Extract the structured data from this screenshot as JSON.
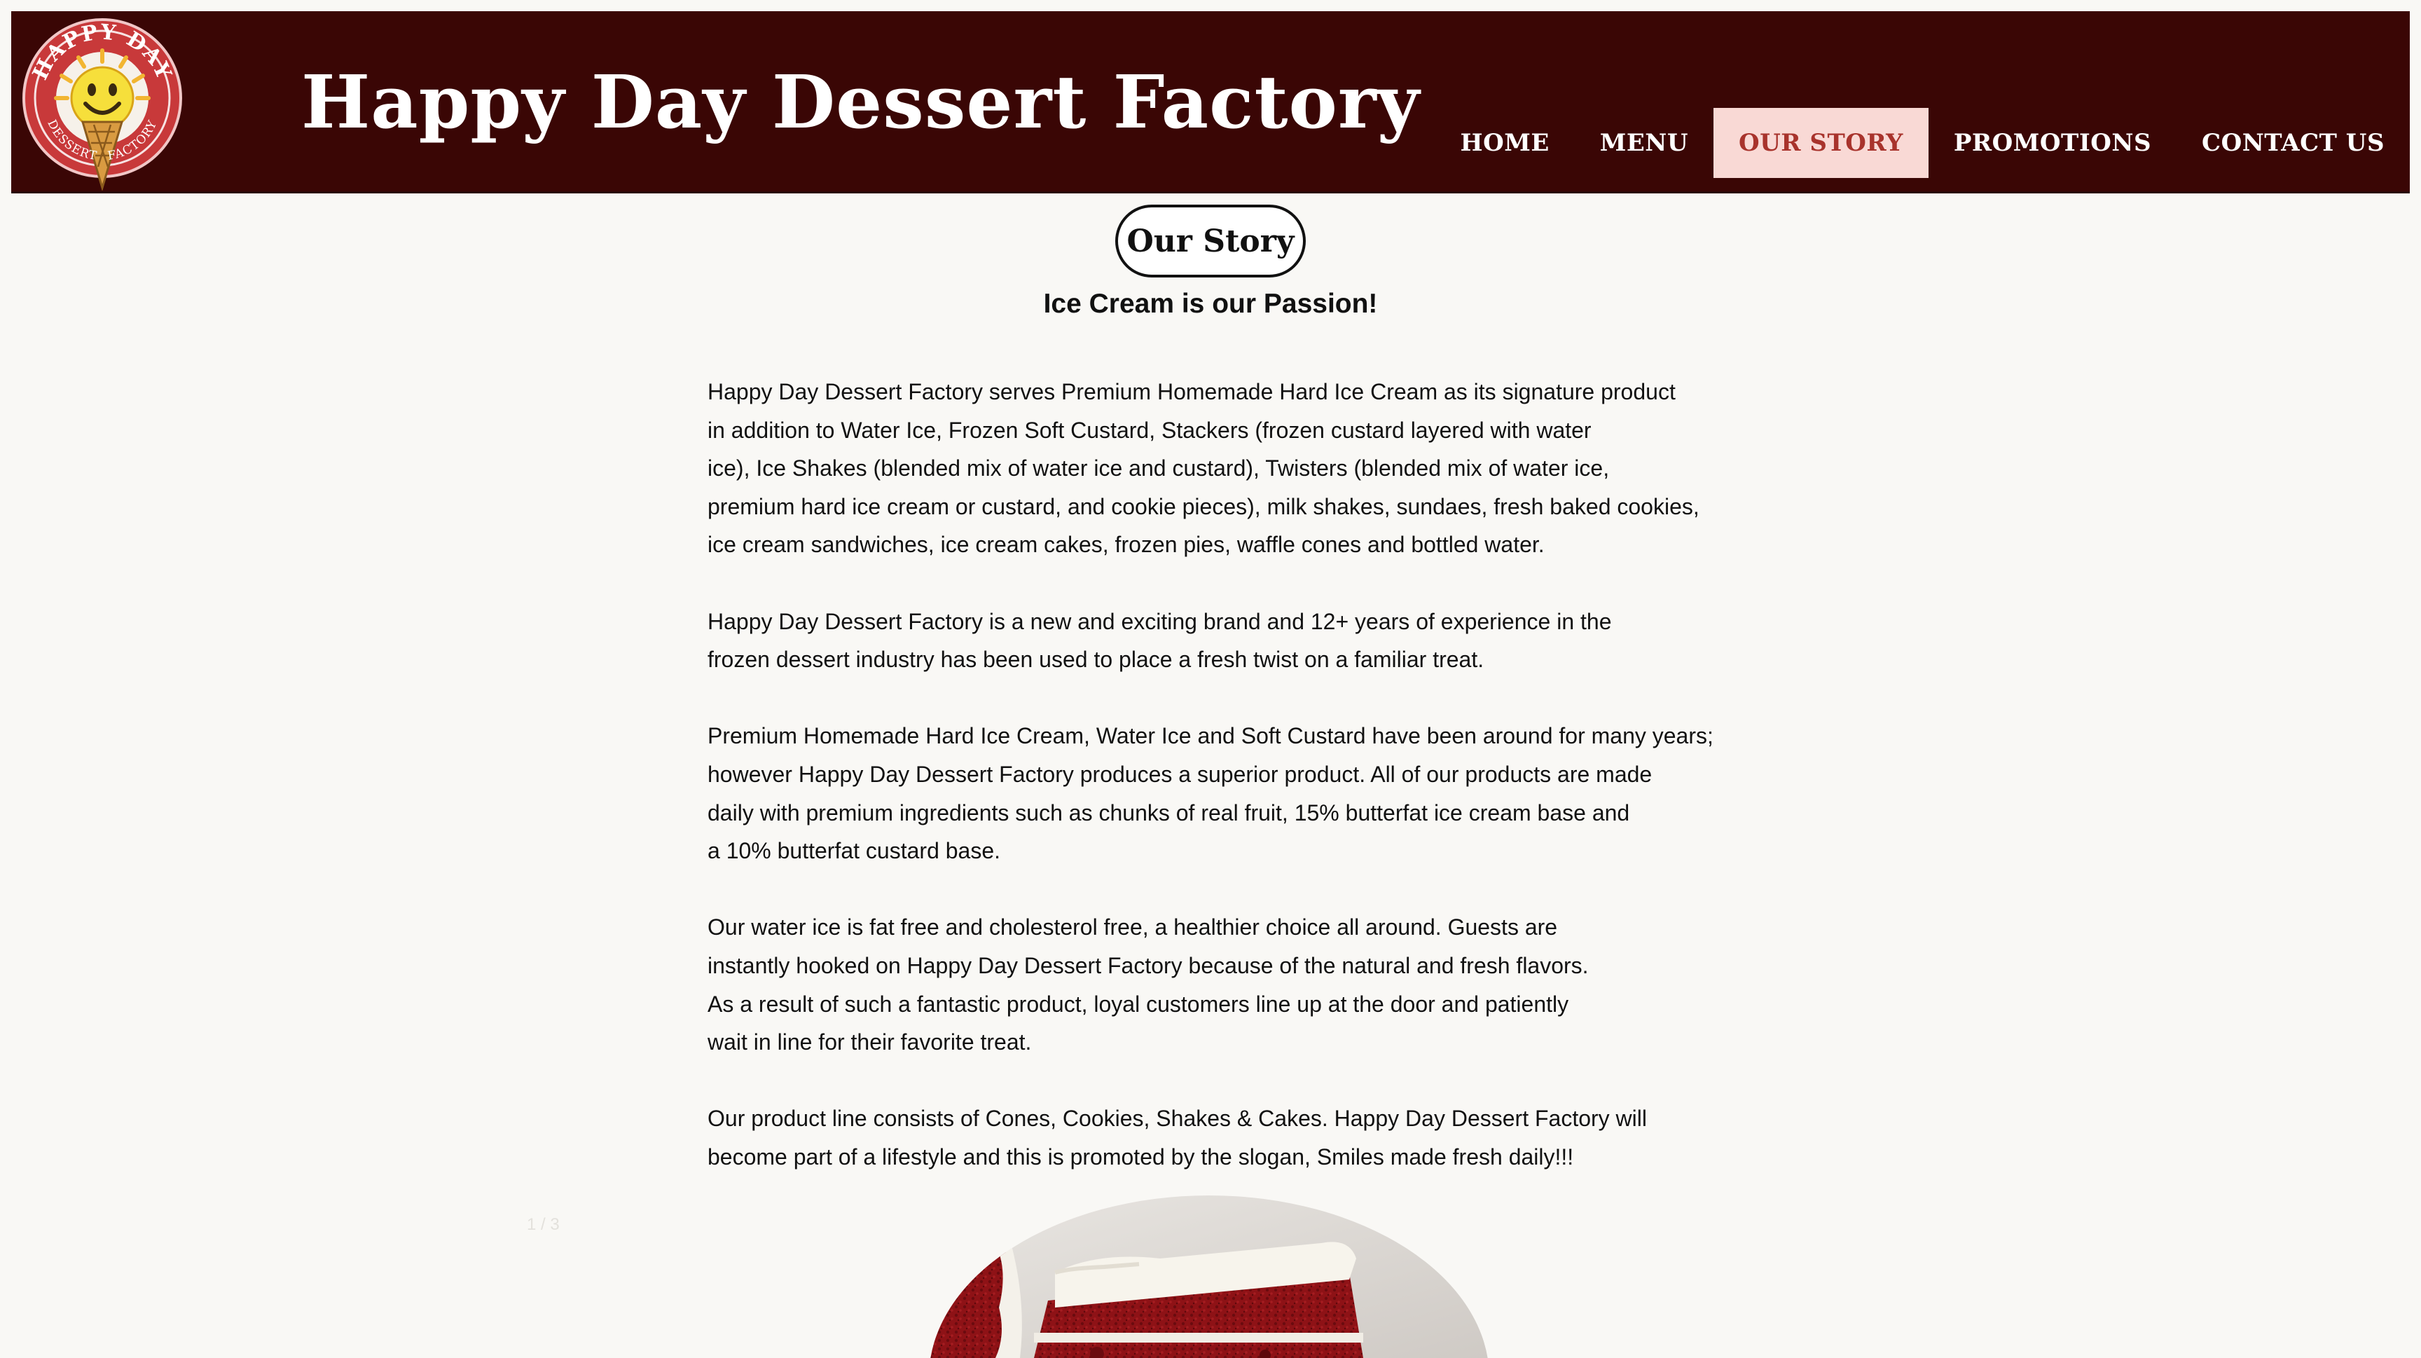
{
  "header": {
    "site_title": "Happy Day Dessert Factory",
    "logo": {
      "top_text": "HAPPY DAY",
      "bottom_left_text": "DESSERT",
      "bottom_right_text": "FACTORY",
      "icon": "smiley-ice-cream-cone-icon"
    },
    "nav": [
      {
        "label": "HOME",
        "active": false
      },
      {
        "label": "MENU",
        "active": false
      },
      {
        "label": "OUR STORY",
        "active": true
      },
      {
        "label": "PROMOTIONS",
        "active": false
      },
      {
        "label": "CONTACT US",
        "active": false
      }
    ]
  },
  "main": {
    "page_title": "Our Story",
    "tagline": "Ice Cream is our Passion!",
    "paragraphs": [
      [
        "Happy Day Dessert Factory serves Premium Homemade Hard Ice Cream as its signature product",
        "in addition to Water Ice, Frozen Soft Custard, Stackers (frozen custard layered with water",
        "ice), Ice Shakes (blended mix of water ice and custard), Twisters (blended mix of water ice,",
        "premium hard ice cream or custard, and cookie pieces), milk shakes, sundaes, fresh baked cookies,",
        "ice cream sandwiches, ice cream cakes, frozen pies, waffle cones and bottled water."
      ],
      [
        "Happy Day Dessert Factory is a new and exciting brand and 12+ years of experience in the",
        "frozen dessert industry has been used to place a fresh twist on a familiar treat."
      ],
      [
        "Premium Homemade Hard Ice Cream, Water Ice and Soft Custard have been around for many years;",
        "however Happy Day Dessert Factory produces a superior product. All of our products are made",
        "daily with premium ingredients such as chunks of real fruit, 15% butterfat ice cream base and",
        "a 10% butterfat custard base."
      ],
      [
        "Our water ice is fat free and cholesterol free, a healthier choice all around. Guests are",
        "instantly hooked on Happy Day Dessert Factory because of the natural and fresh flavors.",
        "As a result of such a fantastic product, loyal customers line up at the door and patiently",
        "wait in line for their favorite treat."
      ],
      [
        "Our product line consists of Cones, Cookies, Shakes & Cakes. Happy Day Dessert Factory will",
        "become part of a lifestyle and this is promoted by the slogan, Smiles made fresh daily!!!"
      ]
    ],
    "slideshow": {
      "counter": "1 / 3",
      "image": "red-velvet-cake-slice"
    }
  },
  "colors": {
    "header_bg": "#3a0605",
    "nav_active_bg": "#f9d9d5",
    "nav_active_text": "#a8332c",
    "page_bg": "#f9f8f5"
  }
}
